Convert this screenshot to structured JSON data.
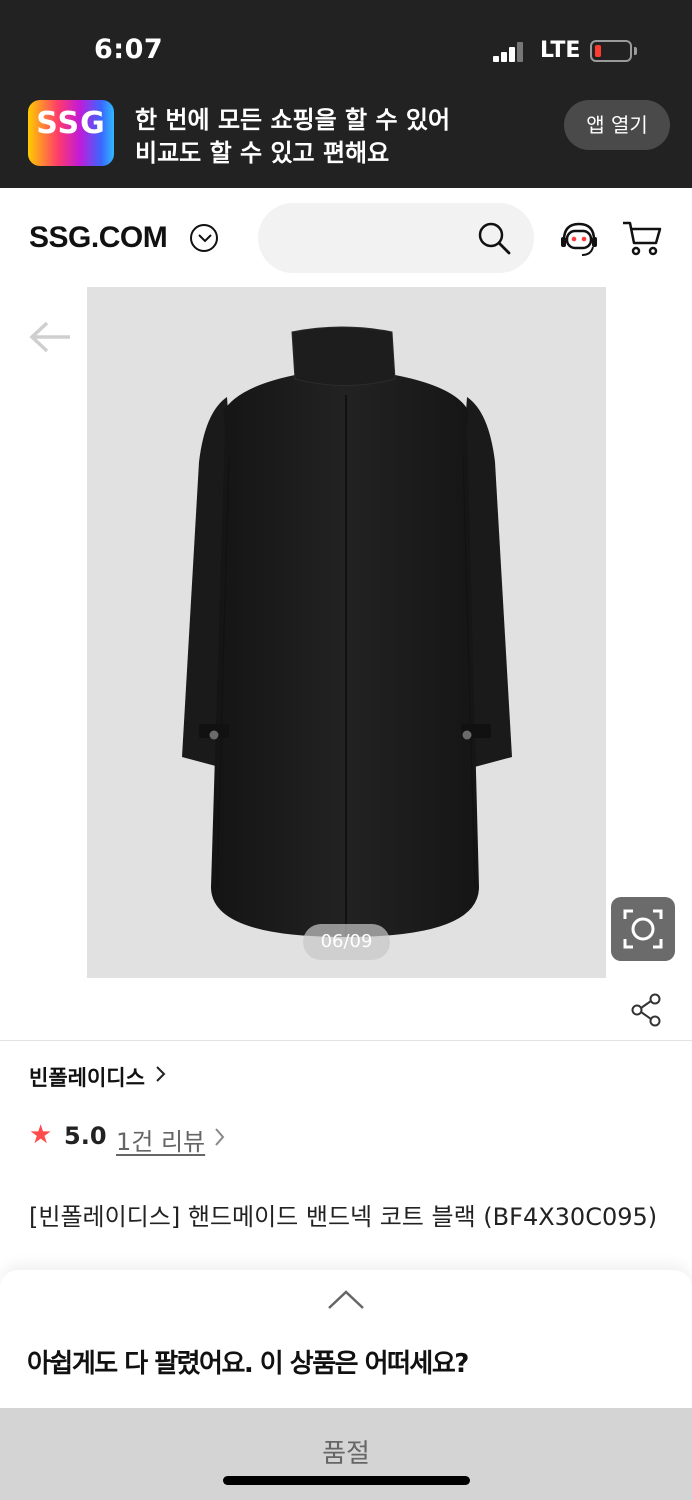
{
  "status_bar": {
    "time": "6:07",
    "network": "LTE"
  },
  "app_banner": {
    "logo_text": "SSG",
    "line1": "한 번에 모든 쇼핑을 할 수 있어",
    "line2": "비교도 할 수 있고 편해요",
    "open_app_label": "앱 열기"
  },
  "header": {
    "brand": "SSG.COM",
    "search_placeholder": ""
  },
  "gallery": {
    "page_indicator": "06/09"
  },
  "product": {
    "brand_name": "빈폴레이디스",
    "rating": "5.0",
    "review_link": "1건 리뷰",
    "name": "[빈폴레이디스] 핸드메이드 밴드넥 코트 블랙 (BF4X30C095)"
  },
  "sheet": {
    "title": "아쉽게도 다 팔렸어요. 이 상품은 어떠세요?",
    "soldout_label": "품절"
  },
  "colors": {
    "banner_bg": "#222222",
    "rating_star": "#ff4b4b",
    "soldout_bg": "#d4d4d4"
  }
}
